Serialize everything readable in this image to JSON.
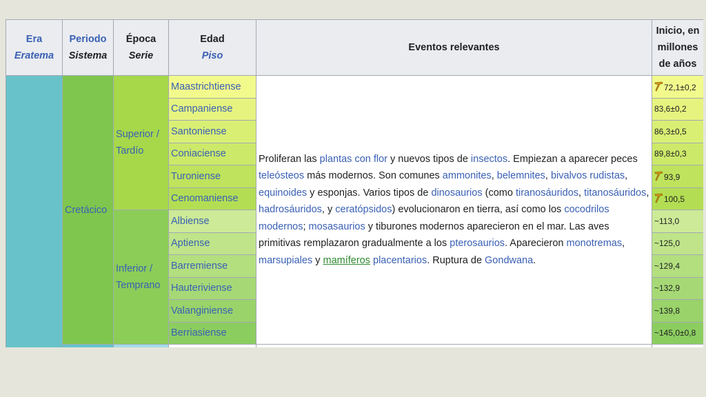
{
  "headers": {
    "era": "Era",
    "eratema": "Eratema",
    "periodo": "Periodo",
    "sistema": "Sistema",
    "epoca": "Época",
    "serie": "Serie",
    "edad": "Edad",
    "piso": "Piso",
    "eventos": "Eventos relevantes",
    "inicio": "Inicio, en millones de años"
  },
  "periodo": "Cretácico",
  "epocas": {
    "superior": "Superior / Tardío",
    "inferior": "Inferior / Temprano"
  },
  "edades": [
    {
      "name": "Maastrichtiense",
      "start": "72,1±0,2",
      "gssp": true,
      "color": "#f2fa8c"
    },
    {
      "name": "Campaniense",
      "start": "83,6±0,2",
      "gssp": false,
      "color": "#e6f47f"
    },
    {
      "name": "Santoniense",
      "start": "86,3±0,5",
      "gssp": false,
      "color": "#d9ef74"
    },
    {
      "name": "Coniaciense",
      "start": "89,8±0,3",
      "gssp": false,
      "color": "#cce96a"
    },
    {
      "name": "Turoniense",
      "start": "93,9",
      "gssp": true,
      "color": "#bfe35d"
    },
    {
      "name": "Cenomaniense",
      "start": "100,5",
      "gssp": true,
      "color": "#b3de53"
    },
    {
      "name": "Albiense",
      "start": "~113,0",
      "gssp": false,
      "color": "#ccea97"
    },
    {
      "name": "Aptiense",
      "start": "~125,0",
      "gssp": false,
      "color": "#bfe48a"
    },
    {
      "name": "Barremiense",
      "start": "~129,4",
      "gssp": false,
      "color": "#b3df7f"
    },
    {
      "name": "Hauteriviense",
      "start": "~132,9",
      "gssp": false,
      "color": "#a6d975"
    },
    {
      "name": "Valanginiense",
      "start": "~139,8",
      "gssp": false,
      "color": "#99d36a"
    },
    {
      "name": "Berriasiense",
      "start": "~145,0±0,8",
      "gssp": false,
      "color": "#8ccd60"
    }
  ],
  "events": [
    {
      "t": "Proliferan las ",
      "link": false
    },
    {
      "t": "plantas con flor",
      "link": true
    },
    {
      "t": " y nuevos tipos de ",
      "link": false
    },
    {
      "t": "insectos",
      "link": true
    },
    {
      "t": ". Empiezan a aparecer peces ",
      "link": false
    },
    {
      "t": "teleósteos",
      "link": true
    },
    {
      "t": " más modernos. Son comunes ",
      "link": false
    },
    {
      "t": "ammonites",
      "link": true
    },
    {
      "t": ", ",
      "link": false
    },
    {
      "t": "belemnites",
      "link": true
    },
    {
      "t": ", ",
      "link": false
    },
    {
      "t": "bivalvos rudistas",
      "link": true
    },
    {
      "t": ", ",
      "link": false
    },
    {
      "t": "equinoides",
      "link": true
    },
    {
      "t": " y esponjas. Varios tipos de ",
      "link": false
    },
    {
      "t": "dinosaurios",
      "link": true
    },
    {
      "t": " (como ",
      "link": false
    },
    {
      "t": "tiranosáuridos",
      "link": true
    },
    {
      "t": ", ",
      "link": false
    },
    {
      "t": "titanosáuridos",
      "link": true
    },
    {
      "t": ", ",
      "link": false
    },
    {
      "t": "hadrosáuridos",
      "link": true
    },
    {
      "t": ", y ",
      "link": false
    },
    {
      "t": "ceratópsidos",
      "link": true
    },
    {
      "t": ") evolucionaron en tierra, así como los ",
      "link": false
    },
    {
      "t": "cocodrilos modernos",
      "link": true
    },
    {
      "t": "; ",
      "link": false
    },
    {
      "t": "mosasaurios",
      "link": true
    },
    {
      "t": " y tiburones modernos aparecieron en el mar. Las aves primitivas remplazaron gradualmente a los ",
      "link": false
    },
    {
      "t": "pterosaurios",
      "link": true
    },
    {
      "t": ". Aparecieron ",
      "link": false
    },
    {
      "t": "monotremas",
      "link": true
    },
    {
      "t": ", ",
      "link": false
    },
    {
      "t": "marsupiales",
      "link": true
    },
    {
      "t": " y ",
      "link": false
    },
    {
      "t": "mamíferos",
      "link": true,
      "visited": true
    },
    {
      "t": " ",
      "link": false
    },
    {
      "t": "placentarios",
      "link": true
    },
    {
      "t": ". Ruptura de ",
      "link": false
    },
    {
      "t": "Gondwana",
      "link": true
    },
    {
      "t": ".",
      "link": false
    }
  ],
  "colors": {
    "era": "#67c3c9",
    "periodo": "#7fc64e",
    "superior": "#a6d84a",
    "inferior": "#8ccd57",
    "link": "#3a60b4",
    "visited_link": "#2f8a2f",
    "header_bg": "#eaecf0"
  }
}
